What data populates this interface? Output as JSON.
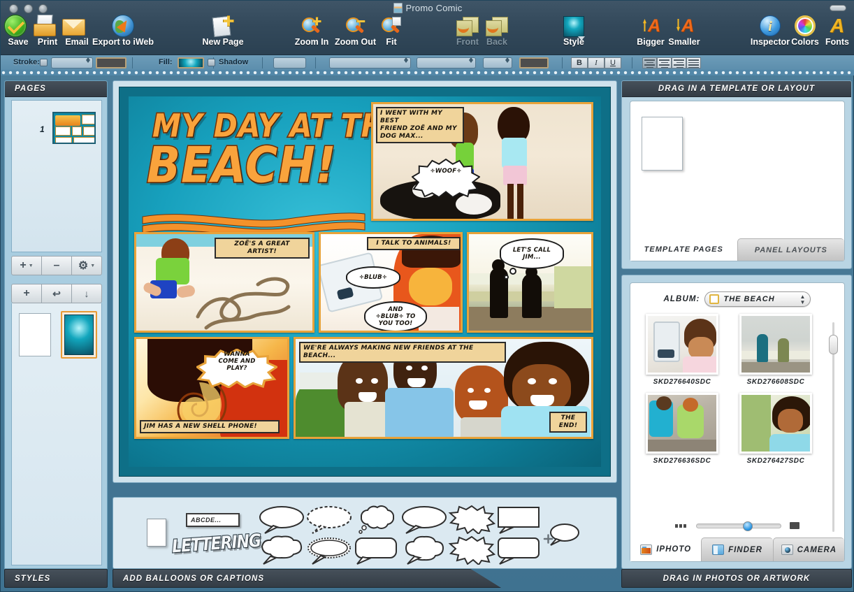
{
  "window": {
    "title": "Promo Comic"
  },
  "toolbar": {
    "items": [
      {
        "label": "Save",
        "icon": "save-disc-icon",
        "enabled": true
      },
      {
        "label": "Print",
        "icon": "printer-icon",
        "enabled": true
      },
      {
        "label": "Email",
        "icon": "envelope-icon",
        "enabled": true
      },
      {
        "label": "Export to iWeb",
        "icon": "globe-arrow-icon",
        "enabled": true
      },
      {
        "label": "New Page",
        "icon": "new-page-icon",
        "enabled": true
      },
      {
        "label": "Zoom In",
        "icon": "magnifier-plus-icon",
        "enabled": true
      },
      {
        "label": "Zoom Out",
        "icon": "magnifier-minus-icon",
        "enabled": true
      },
      {
        "label": "Fit",
        "icon": "magnifier-fit-icon",
        "enabled": true
      },
      {
        "label": "Front",
        "icon": "bring-front-icon",
        "enabled": false
      },
      {
        "label": "Back",
        "icon": "send-back-icon",
        "enabled": false
      },
      {
        "label": "Style",
        "icon": "style-swatch-icon",
        "enabled": true
      },
      {
        "label": "Bigger",
        "icon": "text-bigger-icon",
        "enabled": true
      },
      {
        "label": "Smaller",
        "icon": "text-smaller-icon",
        "enabled": true
      },
      {
        "label": "Inspector",
        "icon": "inspector-info-icon",
        "enabled": true
      },
      {
        "label": "Colors",
        "icon": "color-wheel-icon",
        "enabled": true
      },
      {
        "label": "Fonts",
        "icon": "fonts-a-icon",
        "enabled": true
      }
    ]
  },
  "formatbar": {
    "stroke_label": "Stroke:",
    "fill_label": "Fill:",
    "shadow_label": "Shadow",
    "bold_label": "B",
    "italic_label": "I",
    "underline_label": "U",
    "stroke_color": "#4d4d4d",
    "fill_color": "#12a6bd"
  },
  "sidebar": {
    "header": "PAGES",
    "footer": "STYLES",
    "pages": [
      {
        "number": "1"
      }
    ],
    "page_buttons": [
      {
        "name": "add-page-button",
        "glyph": "+",
        "has_menu": true
      },
      {
        "name": "remove-page-button",
        "glyph": "–",
        "has_menu": false
      },
      {
        "name": "page-settings-button",
        "glyph": "⚙",
        "has_menu": true
      }
    ],
    "style_buttons": [
      {
        "name": "add-style-button",
        "glyph": "+"
      },
      {
        "name": "revert-style-button",
        "glyph": "↩"
      },
      {
        "name": "apply-style-button",
        "glyph": "↓"
      }
    ],
    "styles": [
      {
        "name": "style-white",
        "color": "#ffffff",
        "selected": false
      },
      {
        "name": "style-teal-glow",
        "color": "#12a6bd",
        "selected": true
      }
    ]
  },
  "comic": {
    "title_line1": "MY DAY AT THE",
    "title_line2": "BEACH!",
    "panels": [
      {
        "name": "panel-intro",
        "caption": "I WENT WITH MY BEST\nFRIEND ZOË AND MY\nDOG MAX...",
        "balloons": [
          {
            "text": "÷WOOF÷",
            "shape": "burst"
          }
        ]
      },
      {
        "name": "panel-sand-art",
        "caption": "ZOË'S A GREAT ARTIST!",
        "balloons": []
      },
      {
        "name": "panel-talk-to-animals",
        "caption": "I TALK TO ANIMALS!",
        "balloons": [
          {
            "text": "÷BLUB÷",
            "shape": "oval"
          },
          {
            "text": "AND\n÷BLUB÷ TO\nYOU TOO!",
            "shape": "oval"
          }
        ]
      },
      {
        "name": "panel-silhouettes",
        "caption": "",
        "balloons": [
          {
            "text": "LET'S CALL\nJIM...",
            "shape": "thought"
          }
        ]
      },
      {
        "name": "panel-shell-phone",
        "caption": "JIM HAS A NEW SHELL PHONE!",
        "balloons": [
          {
            "text": "WANNA\nCOME AND\nPLAY?",
            "shape": "burst"
          }
        ]
      },
      {
        "name": "panel-friends",
        "caption": "WE'RE ALWAYS MAKING NEW FRIENDS AT THE BEACH...",
        "end_caption": "THE END!",
        "balloons": []
      }
    ]
  },
  "templates": {
    "header": "DRAG IN A TEMPLATE OR LAYOUT",
    "tabs": [
      {
        "label": "TEMPLATE PAGES",
        "active": true
      },
      {
        "label": "PANEL LAYOUTS",
        "active": false
      }
    ]
  },
  "photos": {
    "footer": "DRAG IN PHOTOS OR ARTWORK",
    "album_label": "ALBUM:",
    "album_value": "THE BEACH",
    "items": [
      {
        "name": "SKD276640SDC"
      },
      {
        "name": "SKD276608SDC"
      },
      {
        "name": "SKD276636SDC"
      },
      {
        "name": "SKD276427SDC"
      }
    ],
    "tabs": [
      {
        "label": "IPHOTO",
        "icon": "iphoto-icon",
        "active": true
      },
      {
        "label": "FINDER",
        "icon": "finder-icon",
        "active": false
      },
      {
        "label": "CAMERA",
        "icon": "camera-icon",
        "active": false
      }
    ]
  },
  "balloons_panel": {
    "footer": "ADD BALLOONS OR CAPTIONS",
    "textbox_sample": "ABCDE...",
    "lettering_sample": "LETTERING",
    "shapes": [
      "speech-oval",
      "speech-dashed-oval",
      "speech-cloud",
      "speech-oval-2",
      "speech-burst",
      "speech-rect",
      "speech-bumpy",
      "speech-spiky-oval",
      "speech-rect-round",
      "thought-cloud",
      "burst-jagged",
      "speech-rounded-rect",
      "add-balloon"
    ]
  }
}
